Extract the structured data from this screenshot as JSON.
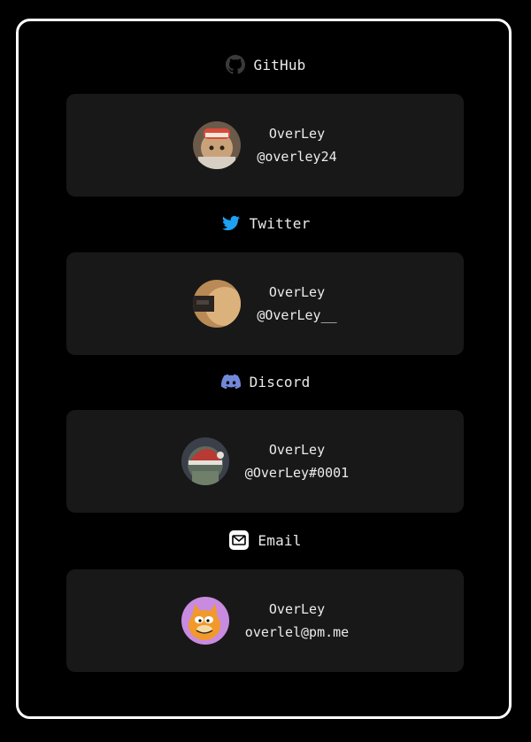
{
  "accounts": [
    {
      "service": "GitHub",
      "icon": "github-icon",
      "display_name": "OverLey",
      "handle": "@overley24"
    },
    {
      "service": "Twitter",
      "icon": "twitter-icon",
      "display_name": "OverLey",
      "handle": "@OverLey__"
    },
    {
      "service": "Discord",
      "icon": "discord-icon",
      "display_name": "OverLey",
      "handle": "@OverLey#0001"
    },
    {
      "service": "Email",
      "icon": "email-icon",
      "display_name": "OverLey",
      "handle": "overlel@pm.me"
    }
  ],
  "colors": {
    "background": "#000000",
    "card": "#181818",
    "frame_border": "#ffffff",
    "twitter_blue": "#1da1f2",
    "discord_blurple": "#7289da"
  }
}
